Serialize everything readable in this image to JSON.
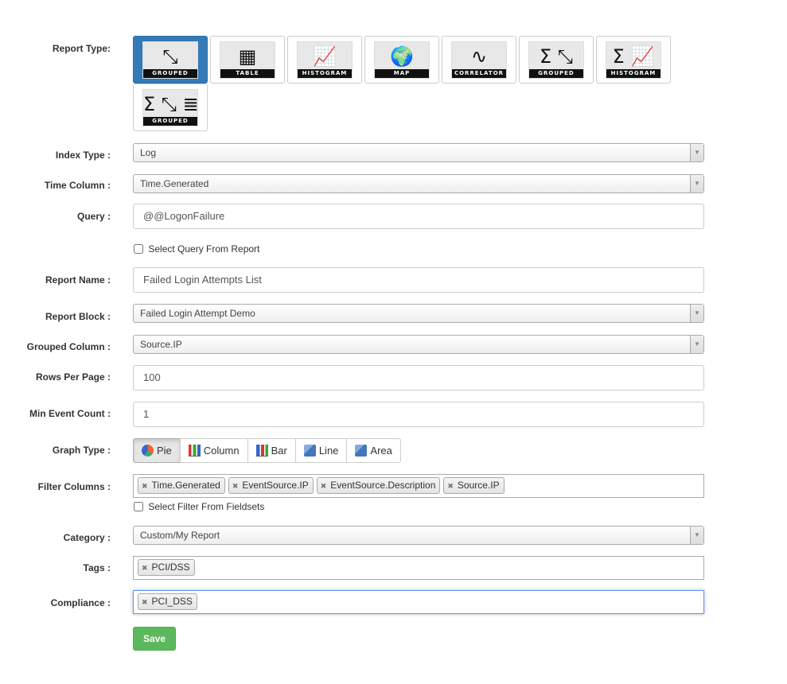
{
  "labels": {
    "report_type": "Report Type:",
    "index_type": "Index Type :",
    "time_column": "Time Column :",
    "query": "Query :",
    "report_name": "Report Name :",
    "report_block": "Report Block :",
    "grouped_column": "Grouped Column :",
    "rows_per_page": "Rows Per Page :",
    "min_event_count": "Min Event Count :",
    "graph_type": "Graph Type :",
    "filter_columns": "Filter Columns :",
    "category": "Category :",
    "tags": "Tags :",
    "compliance": "Compliance :"
  },
  "report_types": [
    {
      "caption": "GROUPED",
      "icon": "compress-arrows-icon",
      "glyph": "⤡",
      "active": true
    },
    {
      "caption": "TABLE",
      "icon": "table-icon",
      "glyph": "▦",
      "active": false
    },
    {
      "caption": "HISTOGRAM",
      "icon": "histogram-icon",
      "glyph": "📈",
      "active": false
    },
    {
      "caption": "MAP",
      "icon": "globe-pin-icon",
      "glyph": "🌍",
      "active": false
    },
    {
      "caption": "CORRELATOR",
      "icon": "correlator-icon",
      "glyph": "∿",
      "active": false
    },
    {
      "caption": "GROUPED",
      "icon": "sigma-compress-icon",
      "glyph": "Σ ⤡",
      "active": false
    },
    {
      "caption": "HISTOGRAM",
      "icon": "sigma-histogram-icon",
      "glyph": "Σ 📈",
      "active": false
    },
    {
      "caption": "GROUPED",
      "icon": "sigma-compress-list-icon",
      "glyph": "Σ ⤡ ≣",
      "active": false
    }
  ],
  "fields": {
    "index_type": "Log",
    "time_column": "Time.Generated",
    "query": "@@LogonFailure",
    "select_query_from_report": "Select Query From Report",
    "report_name": "Failed Login Attempts List",
    "report_block": "Failed Login Attempt Demo",
    "grouped_column": "Source.IP",
    "rows_per_page": "100",
    "min_event_count": "1",
    "select_filter_from_fieldsets": "Select Filter From Fieldsets",
    "category": "Custom/My Report"
  },
  "graph_types": [
    {
      "label": "Pie",
      "icon": "pie-chart-icon",
      "active": true
    },
    {
      "label": "Column",
      "icon": "column-chart-icon",
      "active": false
    },
    {
      "label": "Bar",
      "icon": "bar-chart-icon",
      "active": false
    },
    {
      "label": "Line",
      "icon": "line-chart-icon",
      "active": false
    },
    {
      "label": "Area",
      "icon": "area-chart-icon",
      "active": false
    }
  ],
  "filter_columns": [
    "Time.Generated",
    "EventSource.IP",
    "EventSource.Description",
    "Source.IP"
  ],
  "tags": [
    "PCI/DSS"
  ],
  "compliance": [
    "PCI_DSS"
  ],
  "save_label": "Save",
  "colors": {
    "primary": "#337ab7",
    "success": "#5cb85c"
  }
}
